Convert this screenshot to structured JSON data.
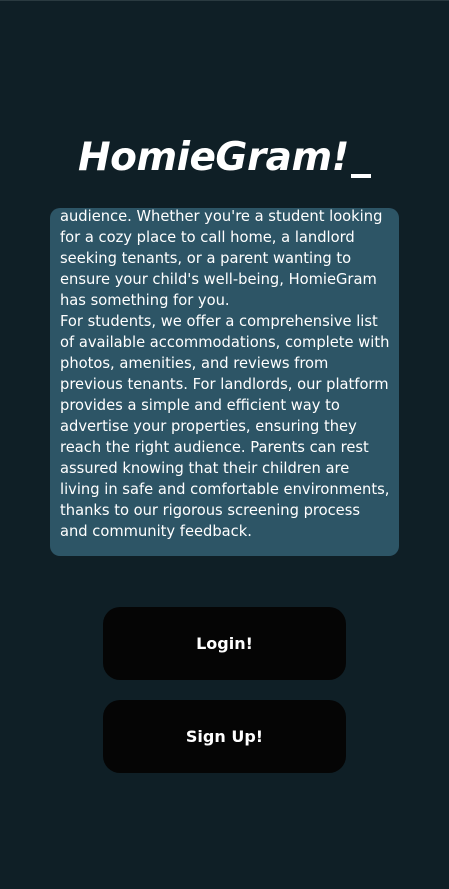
{
  "app": {
    "title": "HomieGram!"
  },
  "about": {
    "paragraph_1": "Welcome to HomieGram, the platform that connects people looking for accommodation with those who have properties to offer. Our goal is to simplify the search for a home and help property owners reach a wider audience. Whether you're a student looking for a cozy place to call home, a landlord seeking tenants, or a parent wanting to ensure your child's well-being, HomieGram has something for you.",
    "paragraph_2": "For students, we offer a comprehensive list of available accommodations, complete with photos, amenities, and reviews from previous tenants. For landlords, our platform provides a simple and efficient way to advertise your properties, ensuring they reach the right audience. Parents can rest assured knowing that their children are living in safe and comfortable environments, thanks to our rigorous screening process and community feedback."
  },
  "actions": {
    "login_label": "Login!",
    "signup_label": "Sign Up!"
  },
  "colors": {
    "background": "#0f1f26",
    "card": "#2d5566",
    "button": "#050505",
    "text": "#ffffff"
  }
}
